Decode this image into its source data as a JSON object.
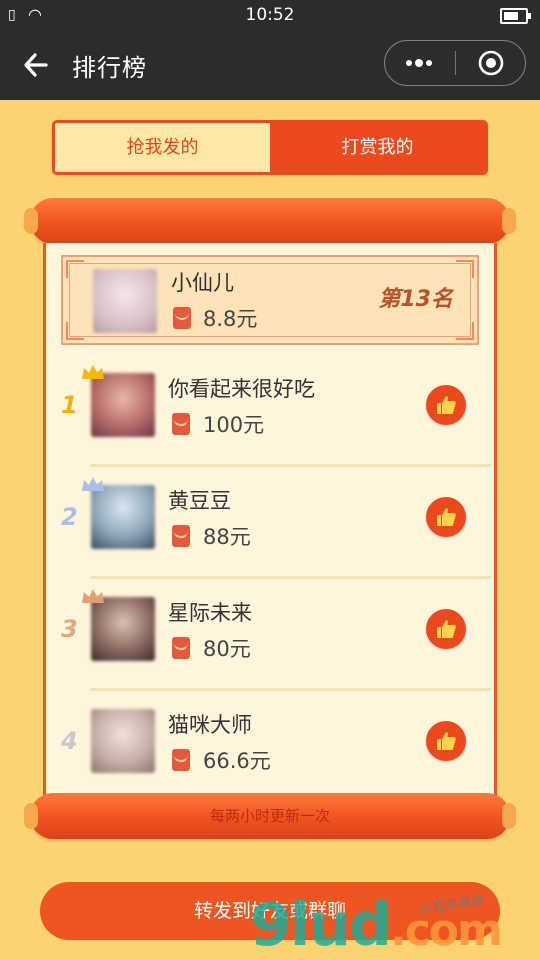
{
  "status_bar": {
    "time": "10:52"
  },
  "nav": {
    "title": "排行榜"
  },
  "tabs": [
    {
      "label": "抢我发的"
    },
    {
      "label": "打赏我的"
    }
  ],
  "my_entry": {
    "name": "小仙儿",
    "amount": "8.8元",
    "rank_label": "第13名"
  },
  "ranking": [
    {
      "rank": "1",
      "name": "你看起来很好吃",
      "amount": "100元",
      "crown_color": "#f7b800"
    },
    {
      "rank": "2",
      "name": "黄豆豆",
      "amount": "88元",
      "crown_color": "#a9bfe6"
    },
    {
      "rank": "3",
      "name": "星际未来",
      "amount": "80元",
      "crown_color": "#e0a070"
    },
    {
      "rank": "4",
      "name": "猫咪大师",
      "amount": "66.6元",
      "crown_color": ""
    }
  ],
  "footer_note": "每两小时更新一次",
  "share_button": {
    "label": "转发到好友或群聊"
  },
  "watermark": {
    "main": "9lud",
    "dot_com": ".com",
    "sub": "小程序商店"
  },
  "colors": {
    "accent": "#ea4a1d",
    "background": "#fbd471",
    "rank_colors": [
      "#f2b20c",
      "#a9bfe6",
      "#deaa7e",
      "#c8c8c8"
    ]
  }
}
